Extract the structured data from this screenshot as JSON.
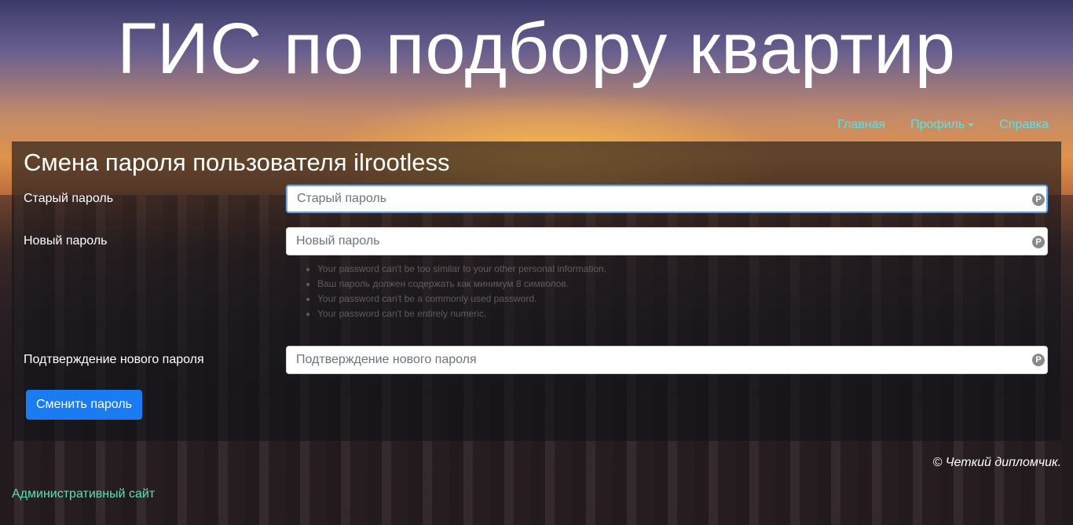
{
  "header": {
    "title": "ГИС по подбору квартир"
  },
  "nav": {
    "home": "Главная",
    "profile": "Профиль",
    "help": "Справка"
  },
  "form": {
    "heading": "Смена пароля пользователя ilrootless",
    "old_password": {
      "label": "Старый пароль",
      "placeholder": "Старый пароль"
    },
    "new_password": {
      "label": "Новый пароль",
      "placeholder": "Новый пароль"
    },
    "confirm_password": {
      "label": "Подтверждение нового пароля",
      "placeholder": "Подтверждение нового пароля"
    },
    "help_items": [
      "Your password can't be too similar to your other personal information.",
      "Ваш пароль должен содержать как минимум 8 символов.",
      "Your password can't be a commonly used password.",
      "Your password can't be entirely numeric."
    ],
    "submit_label": "Сменить пароль",
    "field_icon": "password-manager-icon"
  },
  "footer": {
    "copyright": "© Четкий дипломчик.",
    "admin_link": "Административный сайт"
  },
  "colors": {
    "nav_link": "#5ee0e6",
    "primary_button": "#1a7cf2",
    "admin_link": "#5ee0b0"
  }
}
